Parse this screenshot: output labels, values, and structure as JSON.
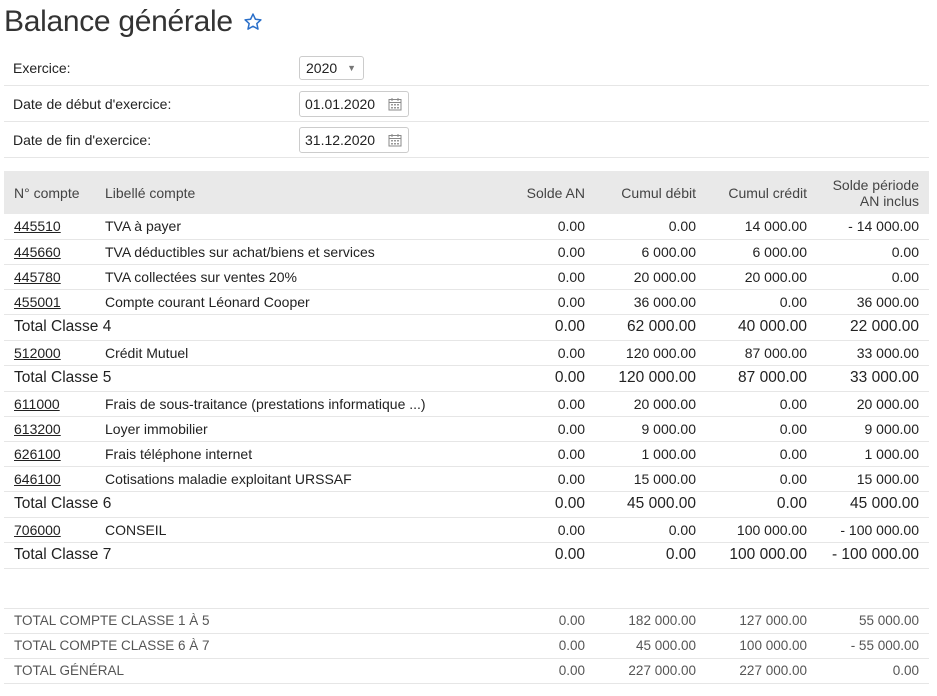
{
  "page": {
    "title": "Balance générale"
  },
  "form": {
    "exercice": {
      "label": "Exercice:",
      "value": "2020"
    },
    "debut": {
      "label": "Date de début d'exercice:",
      "value": "01.01.2020"
    },
    "fin": {
      "label": "Date de fin d'exercice:",
      "value": "31.12.2020"
    }
  },
  "table": {
    "headers": {
      "compte": "N° compte",
      "libelle": "Libellé compte",
      "solde_an": "Solde AN",
      "cumul_debit": "Cumul débit",
      "cumul_credit": "Cumul crédit",
      "solde_periode_1": "Solde période",
      "solde_periode_2": "AN inclus"
    },
    "rows": [
      {
        "compte": "445510",
        "libelle": "TVA à payer",
        "solde_an": "0.00",
        "debit": "0.00",
        "credit": "14 000.00",
        "solde": "- 14 000.00"
      },
      {
        "compte": "445660",
        "libelle": "TVA déductibles sur achat/biens et services",
        "solde_an": "0.00",
        "debit": "6 000.00",
        "credit": "6 000.00",
        "solde": "0.00"
      },
      {
        "compte": "445780",
        "libelle": "TVA collectées sur ventes 20%",
        "solde_an": "0.00",
        "debit": "20 000.00",
        "credit": "20 000.00",
        "solde": "0.00"
      },
      {
        "compte": "455001",
        "libelle": "Compte courant Léonard Cooper",
        "solde_an": "0.00",
        "debit": "36 000.00",
        "credit": "0.00",
        "solde": "36 000.00"
      },
      {
        "label": "Total Classe 4",
        "solde_an": "0.00",
        "debit": "62 000.00",
        "credit": "40 000.00",
        "solde": "22 000.00"
      },
      {
        "compte": "512000",
        "libelle": "Crédit Mutuel",
        "solde_an": "0.00",
        "debit": "120 000.00",
        "credit": "87 000.00",
        "solde": "33 000.00"
      },
      {
        "label": "Total Classe 5",
        "solde_an": "0.00",
        "debit": "120 000.00",
        "credit": "87 000.00",
        "solde": "33 000.00"
      },
      {
        "compte": "611000",
        "libelle": "Frais de sous-traitance (prestations informatique ...)",
        "solde_an": "0.00",
        "debit": "20 000.00",
        "credit": "0.00",
        "solde": "20 000.00"
      },
      {
        "compte": "613200",
        "libelle": "Loyer immobilier",
        "solde_an": "0.00",
        "debit": "9 000.00",
        "credit": "0.00",
        "solde": "9 000.00"
      },
      {
        "compte": "626100",
        "libelle": "Frais téléphone internet",
        "solde_an": "0.00",
        "debit": "1 000.00",
        "credit": "0.00",
        "solde": "1 000.00"
      },
      {
        "compte": "646100",
        "libelle": "Cotisations maladie exploitant URSSAF",
        "solde_an": "0.00",
        "debit": "15 000.00",
        "credit": "0.00",
        "solde": "15 000.00"
      },
      {
        "label": "Total Classe 6",
        "solde_an": "0.00",
        "debit": "45 000.00",
        "credit": "0.00",
        "solde": "45 000.00"
      },
      {
        "compte": "706000",
        "libelle": "CONSEIL",
        "solde_an": "0.00",
        "debit": "0.00",
        "credit": "100 000.00",
        "solde": "- 100 000.00"
      },
      {
        "label": "Total Classe 7",
        "solde_an": "0.00",
        "debit": "0.00",
        "credit": "100 000.00",
        "solde": "- 100 000.00"
      }
    ],
    "grand_totals": [
      {
        "label": "TOTAL COMPTE CLASSE 1 À 5",
        "solde_an": "0.00",
        "debit": "182 000.00",
        "credit": "127 000.00",
        "solde": "55 000.00"
      },
      {
        "label": "TOTAL COMPTE CLASSE 6 À 7",
        "solde_an": "0.00",
        "debit": "45 000.00",
        "credit": "100 000.00",
        "solde": "- 55 000.00"
      },
      {
        "label": "TOTAL GÉNÉRAL",
        "solde_an": "0.00",
        "debit": "227 000.00",
        "credit": "227 000.00",
        "solde": "0.00"
      }
    ]
  }
}
